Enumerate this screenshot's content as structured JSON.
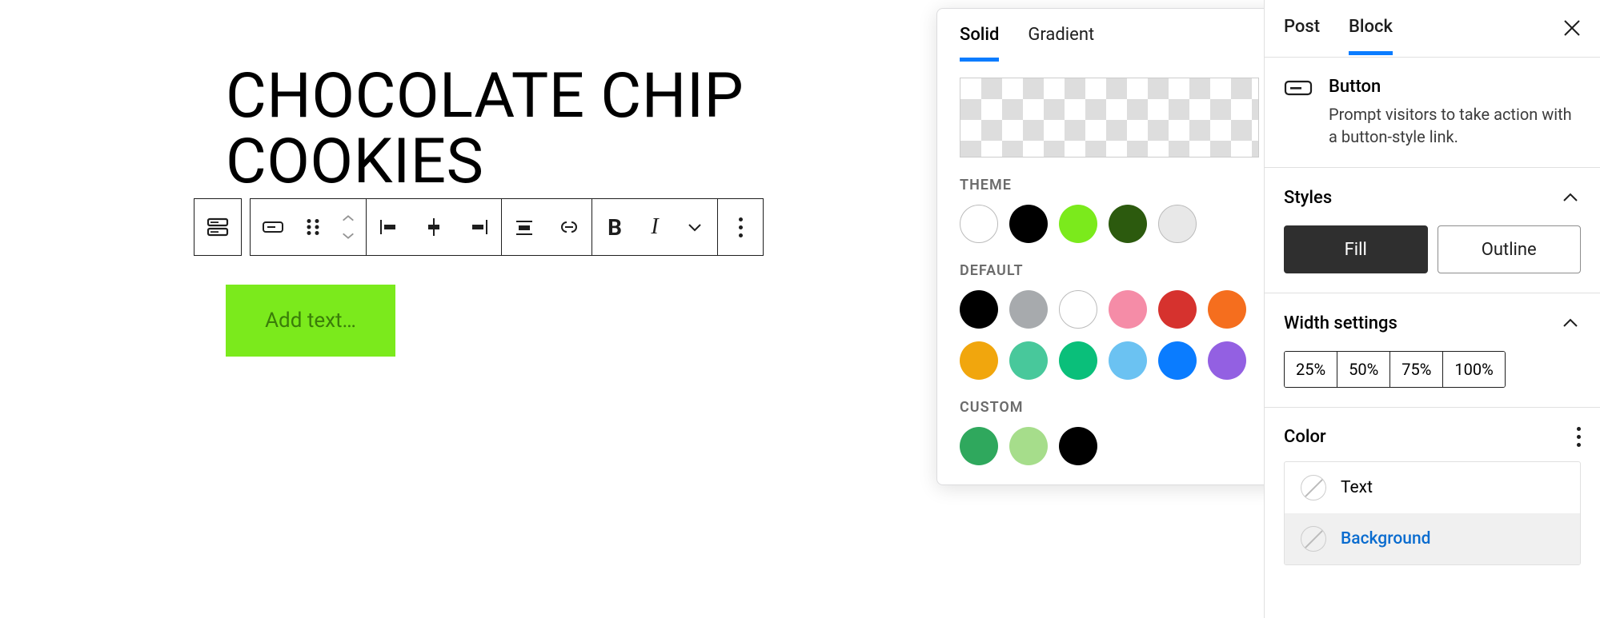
{
  "post": {
    "title": "CHOCOLATE CHIP COOKIES"
  },
  "button_block": {
    "placeholder": "Add text…"
  },
  "color_popover": {
    "tabs": {
      "solid": "Solid",
      "gradient": "Gradient"
    },
    "sections": {
      "theme": "THEME",
      "default": "DEFAULT",
      "custom": "CUSTOM"
    },
    "theme_colors": [
      "#ffffff",
      "#000000",
      "#7bea1c",
      "#2c5a0e",
      "#e8e8e8"
    ],
    "default_colors_row1": [
      "#000000",
      "#a7aaad",
      "#ffffff",
      "#f58ca7",
      "#d6322e",
      "#f56e1e"
    ],
    "default_colors_row2": [
      "#f1a60d",
      "#48c89b",
      "#0abf7a",
      "#6bc2f2",
      "#0a7cff",
      "#9360e2"
    ],
    "custom_colors": [
      "#2fa85d",
      "#a6dd8b",
      "#000000"
    ]
  },
  "sidebar": {
    "tabs": {
      "post": "Post",
      "block": "Block"
    },
    "block_info": {
      "name": "Button",
      "description": "Prompt visitors to take action with a button-style link."
    },
    "panels": {
      "styles": {
        "title": "Styles",
        "fill": "Fill",
        "outline": "Outline"
      },
      "width": {
        "title": "Width settings",
        "options": [
          "25%",
          "50%",
          "75%",
          "100%"
        ]
      },
      "color": {
        "title": "Color",
        "text": "Text",
        "background": "Background"
      }
    }
  }
}
